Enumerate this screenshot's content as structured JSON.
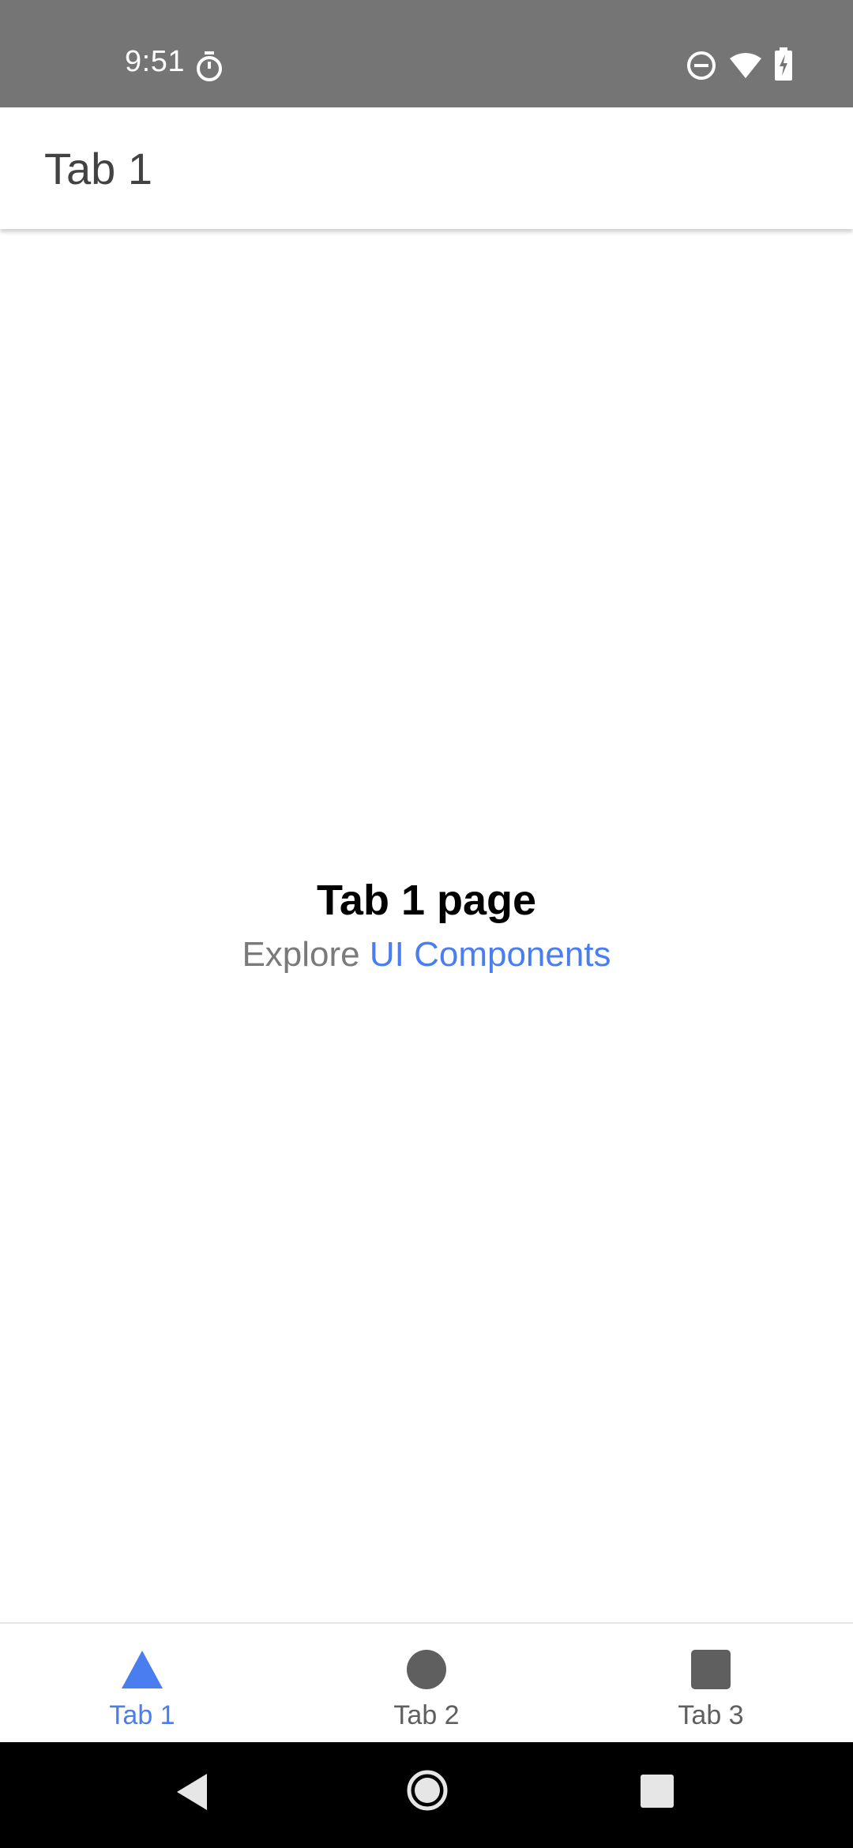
{
  "status_bar": {
    "time": "9:51",
    "icons": [
      "timer-icon",
      "do-not-disturb-icon",
      "wifi-icon",
      "battery-charging-icon"
    ],
    "background": "#757575"
  },
  "header": {
    "title": "Tab 1"
  },
  "main": {
    "page_title": "Tab 1 page",
    "explore_prefix": "Explore ",
    "explore_link": "UI Components"
  },
  "tabs": [
    {
      "label": "Tab 1",
      "icon": "triangle-icon",
      "selected": true
    },
    {
      "label": "Tab 2",
      "icon": "circle-icon",
      "selected": false
    },
    {
      "label": "Tab 3",
      "icon": "square-icon",
      "selected": false
    }
  ],
  "nav_bar": {
    "buttons": [
      "back-icon",
      "home-icon",
      "recents-icon"
    ]
  },
  "colors": {
    "accent": "#4a7ef0",
    "inactive": "#5f5f5f",
    "header_text": "#424242"
  }
}
